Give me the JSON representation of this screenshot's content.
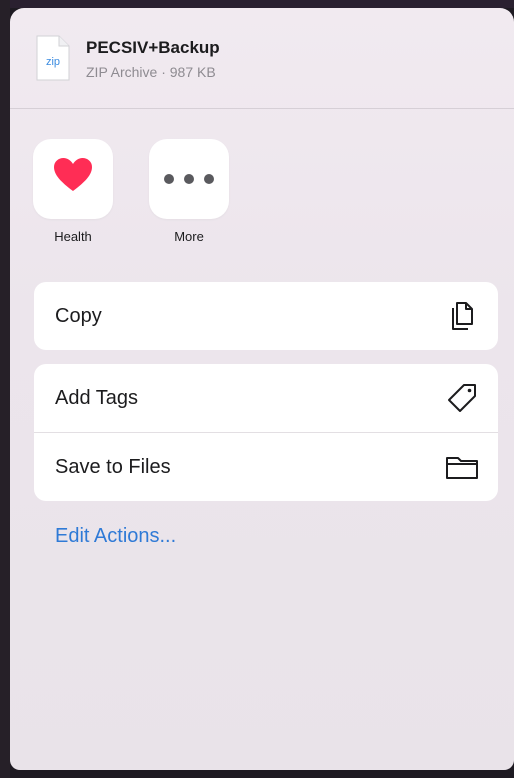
{
  "file": {
    "name": "PECSIV+Backup",
    "meta": "ZIP Archive · 987 KB",
    "icon_label": "zip",
    "icon": "zip-file-icon"
  },
  "apps": [
    {
      "label": "Health",
      "icon": "heart-icon",
      "color": "#ff2d55"
    },
    {
      "label": "More",
      "icon": "ellipsis-icon",
      "color": "#5a5a5e"
    }
  ],
  "actions": {
    "copy_label": "Copy",
    "copy_icon": "copy-icon",
    "add_tags_label": "Add Tags",
    "add_tags_icon": "tag-icon",
    "save_files_label": "Save to Files",
    "save_files_icon": "folder-icon"
  },
  "edit_actions_label": "Edit Actions...",
  "colors": {
    "accent": "#2f7ad6",
    "sheet_bg": "#ece5ec",
    "health_heart": "#ff2d55"
  }
}
